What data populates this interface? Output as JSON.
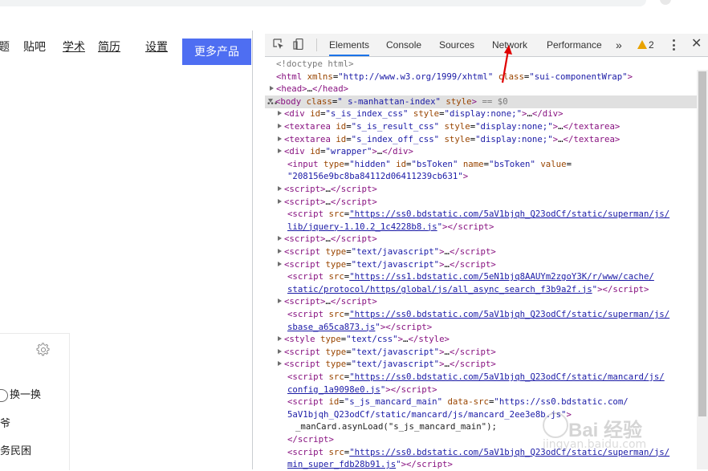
{
  "page": {
    "nav": {
      "item1": "题",
      "tieba": "贴吧",
      "xueshu": "学术",
      "jianli": "简历",
      "shezhi": "设置",
      "more_button": "更多产品"
    },
    "panel": {
      "refresh_label": "换一换",
      "item1": "爷",
      "item2": "务民困"
    }
  },
  "devtools": {
    "tabs": [
      "Elements",
      "Console",
      "Sources",
      "Network",
      "Performance"
    ],
    "active_tab": "Elements",
    "overflow": "»",
    "warning_count": "2",
    "close": "✕",
    "dom_lines": [
      {
        "indent": 0,
        "html": "<span class='cm'>&lt;!doctype html&gt;</span>"
      },
      {
        "indent": 0,
        "html": "<span class='tg'>&lt;html</span> <span class='an'>xmlns</span>=<span class='av'>\"http://www.w3.org/1999/xhtml\"</span> <span class='an'>class</span>=<span class='av'>\"sui-componentWrap\"</span><span class='tg'>&gt;</span>"
      },
      {
        "indent": 1,
        "arrow": "r",
        "html": "<span class='tg'>&lt;head&gt;</span>…<span class='tg'>&lt;/head&gt;</span>"
      },
      {
        "indent": 1,
        "arrow": "d",
        "sel": true,
        "html": "<span class='tg'>&lt;body</span> <span class='an'>class</span>=<span class='av'>\" s-manhattan-index\"</span> <span class='an'>style</span><span class='tg'>&gt;</span> <span class='cm'>== $0</span>"
      },
      {
        "indent": 2,
        "arrow": "r",
        "html": "<span class='tg'>&lt;div</span> <span class='an'>id</span>=<span class='av'>\"s_is_index_css\"</span> <span class='an'>style</span>=<span class='av'>\"display:none;\"</span><span class='tg'>&gt;</span>…<span class='tg'>&lt;/div&gt;</span>"
      },
      {
        "indent": 2,
        "arrow": "r",
        "html": "<span class='tg'>&lt;textarea</span> <span class='an'>id</span>=<span class='av'>\"s_is_result_css\"</span> <span class='an'>style</span>=<span class='av'>\"display:none;\"</span><span class='tg'>&gt;</span>…<span class='tg'>&lt;/textarea&gt;</span>"
      },
      {
        "indent": 2,
        "arrow": "r",
        "html": "<span class='tg'>&lt;textarea</span> <span class='an'>id</span>=<span class='av'>\"s_index_off_css\"</span> <span class='an'>style</span>=<span class='av'>\"display:none;\"</span><span class='tg'>&gt;</span>…<span class='tg'>&lt;/textarea&gt;</span>"
      },
      {
        "indent": 2,
        "arrow": "r",
        "html": "<span class='tg'>&lt;div</span> <span class='an'>id</span>=<span class='av'>\"wrapper\"</span><span class='tg'>&gt;</span>…<span class='tg'>&lt;/div&gt;</span>"
      },
      {
        "indent": 3,
        "html": "<span class='tg'>&lt;input</span> <span class='an'>type</span>=<span class='av'>\"hidden\"</span> <span class='an'>id</span>=<span class='av'>\"bsToken\"</span> <span class='an'>name</span>=<span class='av'>\"bsToken\"</span> <span class='an'>value</span>="
      },
      {
        "indent": 3,
        "html": "<span class='av'>\"208156e9bc8ba84112d06411239cb631\"</span><span class='tg'>&gt;</span>"
      },
      {
        "indent": 2,
        "arrow": "r",
        "html": "<span class='tg'>&lt;script&gt;</span>…<span class='tg'>&lt;/script&gt;</span>"
      },
      {
        "indent": 2,
        "arrow": "r",
        "html": "<span class='tg'>&lt;script&gt;</span>…<span class='tg'>&lt;/script&gt;</span>"
      },
      {
        "indent": 3,
        "html": "<span class='tg'>&lt;script</span> <span class='an'>src</span>=<span class='lk'>\"https://ss0.bdstatic.com/5aV1bjqh_Q23odCf/static/superman/js/</span>"
      },
      {
        "indent": 3,
        "html": "<span class='lk'>lib/jquery-1.10.2_1c4228b8.js</span><span class='av'>\"</span><span class='tg'>&gt;&lt;/script&gt;</span>"
      },
      {
        "indent": 2,
        "arrow": "r",
        "html": "<span class='tg'>&lt;script&gt;</span>…<span class='tg'>&lt;/script&gt;</span>"
      },
      {
        "indent": 2,
        "arrow": "r",
        "html": "<span class='tg'>&lt;script</span> <span class='an'>type</span>=<span class='av'>\"text/javascript\"</span><span class='tg'>&gt;</span>…<span class='tg'>&lt;/script&gt;</span>"
      },
      {
        "indent": 2,
        "arrow": "r",
        "html": "<span class='tg'>&lt;script</span> <span class='an'>type</span>=<span class='av'>\"text/javascript\"</span><span class='tg'>&gt;</span>…<span class='tg'>&lt;/script&gt;</span>"
      },
      {
        "indent": 3,
        "html": "<span class='tg'>&lt;script</span> <span class='an'>src</span>=<span class='lk'>\"https://ss1.bdstatic.com/5eN1bjq8AAUYm2zgoY3K/r/www/cache/</span>"
      },
      {
        "indent": 3,
        "html": "<span class='lk'>static/protocol/https/global/js/all_async_search_f3b9a2f.js</span><span class='av'>\"</span><span class='tg'>&gt;&lt;/script&gt;</span>"
      },
      {
        "indent": 2,
        "arrow": "r",
        "html": "<span class='tg'>&lt;script&gt;</span>…<span class='tg'>&lt;/script&gt;</span>"
      },
      {
        "indent": 3,
        "html": "<span class='tg'>&lt;script</span> <span class='an'>src</span>=<span class='lk'>\"https://ss0.bdstatic.com/5aV1bjqh_Q23odCf/static/superman/js/</span>"
      },
      {
        "indent": 3,
        "html": "<span class='lk'>sbase_a65ca873.js</span><span class='av'>\"</span><span class='tg'>&gt;&lt;/script&gt;</span>"
      },
      {
        "indent": 2,
        "arrow": "r",
        "html": "<span class='tg'>&lt;style</span> <span class='an'>type</span>=<span class='av'>\"text/css\"</span><span class='tg'>&gt;</span>…<span class='tg'>&lt;/style&gt;</span>"
      },
      {
        "indent": 2,
        "arrow": "r",
        "html": "<span class='tg'>&lt;script</span> <span class='an'>type</span>=<span class='av'>\"text/javascript\"</span><span class='tg'>&gt;</span>…<span class='tg'>&lt;/script&gt;</span>"
      },
      {
        "indent": 2,
        "arrow": "r",
        "html": "<span class='tg'>&lt;script</span> <span class='an'>type</span>=<span class='av'>\"text/javascript\"</span><span class='tg'>&gt;</span>…<span class='tg'>&lt;/script&gt;</span>"
      },
      {
        "indent": 3,
        "html": "<span class='tg'>&lt;script</span> <span class='an'>src</span>=<span class='lk'>\"https://ss0.bdstatic.com/5aV1bjqh_Q23odCf/static/mancard/js/</span>"
      },
      {
        "indent": 3,
        "html": "<span class='lk'>config_1a9098e0.js</span><span class='av'>\"</span><span class='tg'>&gt;&lt;/script&gt;</span>"
      },
      {
        "indent": 3,
        "html": "<span class='tg'>&lt;script</span> <span class='an'>id</span>=<span class='av'>\"s_js_mancard_main\"</span> <span class='an'>data-src</span>=<span class='av'>\"https://ss0.bdstatic.com/</span>"
      },
      {
        "indent": 3,
        "html": "<span class='av'>5aV1bjqh_Q23odCf/static/mancard/js/mancard_2ee3e8b.js\"</span><span class='tg'>&gt;</span>"
      },
      {
        "indent": 4,
        "html": "<span class='tx'>_manCard.asynLoad(\"s_js_mancard_main\");</span>"
      },
      {
        "indent": 3,
        "html": "<span class='tg'>&lt;/script&gt;</span>"
      },
      {
        "indent": 3,
        "html": "<span class='tg'>&lt;script</span> <span class='an'>src</span>=<span class='lk'>\"https://ss0.bdstatic.com/5aV1bjqh_Q23odCf/static/superman/js/</span>"
      },
      {
        "indent": 3,
        "html": "<span class='lk'>min_super_fdb28b91.js</span><span class='av'>\"</span><span class='tg'>&gt;&lt;/script&gt;</span>"
      }
    ]
  },
  "watermark": {
    "brand": "Bai 经验",
    "url": "jingyan.baidu.com"
  },
  "colors": {
    "accent": "#4e6ef2",
    "devtools_active": "#1a73e8",
    "tag": "#881280",
    "attr_name": "#994500",
    "attr_value": "#1a1aa6",
    "annotation_arrow": "#e00000"
  }
}
